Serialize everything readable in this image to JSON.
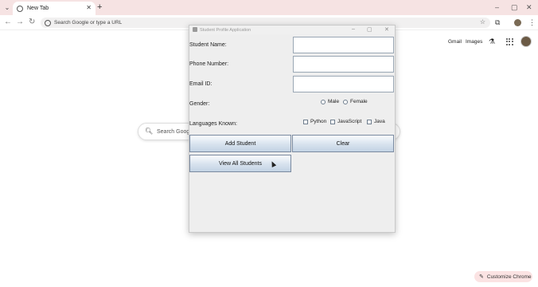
{
  "browser": {
    "tab_title": "New Tab",
    "omnibox_placeholder": "Search Google or type a URL",
    "ntp": {
      "gmail": "Gmail",
      "images": "Images"
    },
    "search_placeholder": "Search Google",
    "customize_label": "Customize Chrome"
  },
  "app": {
    "title": "Student Profile Application",
    "labels": {
      "name": "Student Name:",
      "phone": "Phone Number:",
      "email": "Email ID:",
      "gender": "Gender:",
      "languages": "Languages Known:"
    },
    "gender_options": [
      "Male",
      "Female"
    ],
    "language_options": [
      "Python",
      "JavaScript",
      "Java"
    ],
    "buttons": {
      "add": "Add Student",
      "clear": "Clear",
      "view": "View All Students"
    }
  }
}
